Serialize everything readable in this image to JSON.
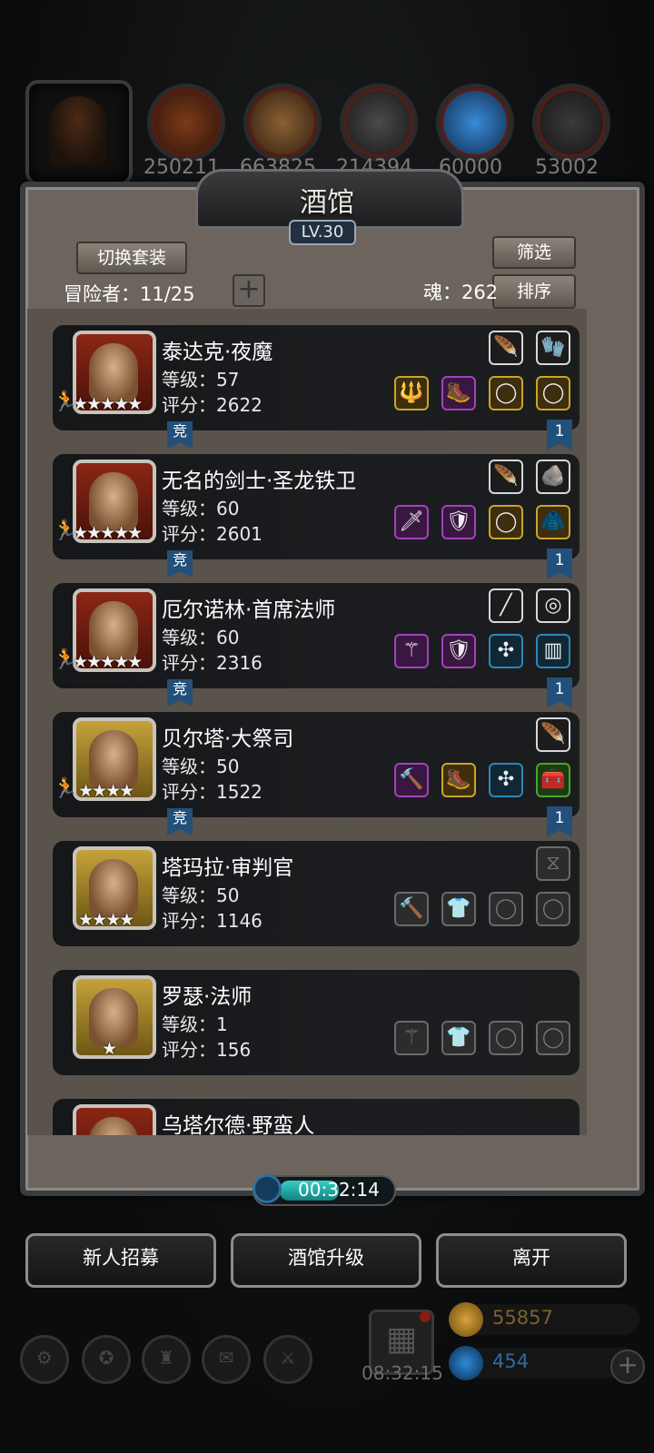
{
  "resources": {
    "values": [
      "250211",
      "663825",
      "214394",
      "60000",
      "53002"
    ],
    "colors": [
      "#7a3a1a",
      "#7a5230",
      "#3a3a3a",
      "#2a70b8",
      "#333333"
    ]
  },
  "panel": {
    "title": "酒馆",
    "level": "LV.30",
    "switch_outfit_label": "切换套装",
    "filter_label": "筛选",
    "sort_label": "排序",
    "adventurers_label": "冒险者：11/25",
    "souls_label": "魂：262",
    "add_button_symbol": "+"
  },
  "adventurers": [
    {
      "name": "泰达克·夜魔",
      "level": "等级：57",
      "score": "评分：2622",
      "stars": "★★★★★",
      "frame": "red",
      "competitive": "竞",
      "rank": "1",
      "top_equips": [
        {
          "cls": "dark",
          "g": "🪶"
        },
        {
          "cls": "dark",
          "g": "🧤"
        }
      ],
      "equips": [
        {
          "cls": "yel",
          "g": "🔱"
        },
        {
          "cls": "pur",
          "g": "🥾"
        },
        {
          "cls": "yel",
          "g": "◯"
        },
        {
          "cls": "yel",
          "g": "◯"
        }
      ]
    },
    {
      "name": "无名的剑士·圣龙铁卫",
      "level": "等级：60",
      "score": "评分：2601",
      "stars": "★★★★★",
      "frame": "red",
      "competitive": "竞",
      "rank": "1",
      "top_equips": [
        {
          "cls": "dark",
          "g": "🪶"
        },
        {
          "cls": "dark",
          "g": "🪨"
        }
      ],
      "equips": [
        {
          "cls": "pur",
          "g": "🗡"
        },
        {
          "cls": "pur",
          "g": "🛡"
        },
        {
          "cls": "yel",
          "g": "◯"
        },
        {
          "cls": "yel",
          "g": "🧥"
        }
      ]
    },
    {
      "name": "厄尔诺林·首席法师",
      "level": "等级：60",
      "score": "评分：2316",
      "stars": "★★★★★",
      "frame": "red",
      "competitive": "竞",
      "rank": "1",
      "top_equips": [
        {
          "cls": "dark",
          "g": "╱"
        },
        {
          "cls": "dark",
          "g": "◎"
        }
      ],
      "equips": [
        {
          "cls": "pur",
          "g": "⚚"
        },
        {
          "cls": "pur",
          "g": "🛡"
        },
        {
          "cls": "blu",
          "g": "✣"
        },
        {
          "cls": "blu",
          "g": "▥"
        }
      ]
    },
    {
      "name": "贝尔塔·大祭司",
      "level": "等级：50",
      "score": "评分：1522",
      "stars": "★★★★",
      "frame": "gold",
      "competitive": "竞",
      "rank": "1",
      "top_equips": [
        {
          "cls": "dark",
          "g": "🪶"
        }
      ],
      "equips": [
        {
          "cls": "pur",
          "g": "🔨"
        },
        {
          "cls": "yel",
          "g": "🥾"
        },
        {
          "cls": "blu",
          "g": "✣"
        },
        {
          "cls": "grn",
          "g": "🧰"
        }
      ]
    },
    {
      "name": "塔玛拉·审判官",
      "level": "等级：50",
      "score": "评分：1146",
      "stars": "★★★★",
      "frame": "gold",
      "competitive": "",
      "rank": "",
      "top_equips": [
        {
          "cls": "empty",
          "g": "⧖"
        }
      ],
      "equips": [
        {
          "cls": "empty",
          "g": "🔨"
        },
        {
          "cls": "empty",
          "g": "👕"
        },
        {
          "cls": "empty",
          "g": "◯"
        },
        {
          "cls": "empty",
          "g": "◯"
        }
      ]
    },
    {
      "name": "罗瑟·法师",
      "level": "等级：1",
      "score": "评分：156",
      "stars": "★",
      "frame": "gold",
      "competitive": "",
      "rank": "",
      "top_equips": [],
      "equips": [
        {
          "cls": "empty",
          "g": "⚚"
        },
        {
          "cls": "empty",
          "g": "👕"
        },
        {
          "cls": "empty",
          "g": "◯"
        },
        {
          "cls": "empty",
          "g": "◯"
        }
      ]
    },
    {
      "name": "乌塔尔德·野蛮人",
      "level": "",
      "score": "",
      "stars": "",
      "frame": "red",
      "competitive": "",
      "rank": "",
      "top_equips": [],
      "equips": []
    }
  ],
  "timer": {
    "value": "00:32:14"
  },
  "actions": {
    "recruit_label": "新人招募",
    "upgrade_label": "酒馆升级",
    "leave_label": "离开"
  },
  "bottom": {
    "gift_time": "08:32:15",
    "gold": "55857",
    "gems": "454",
    "gold_color": "#d8a23a",
    "gem_color": "#2e8ad8"
  }
}
